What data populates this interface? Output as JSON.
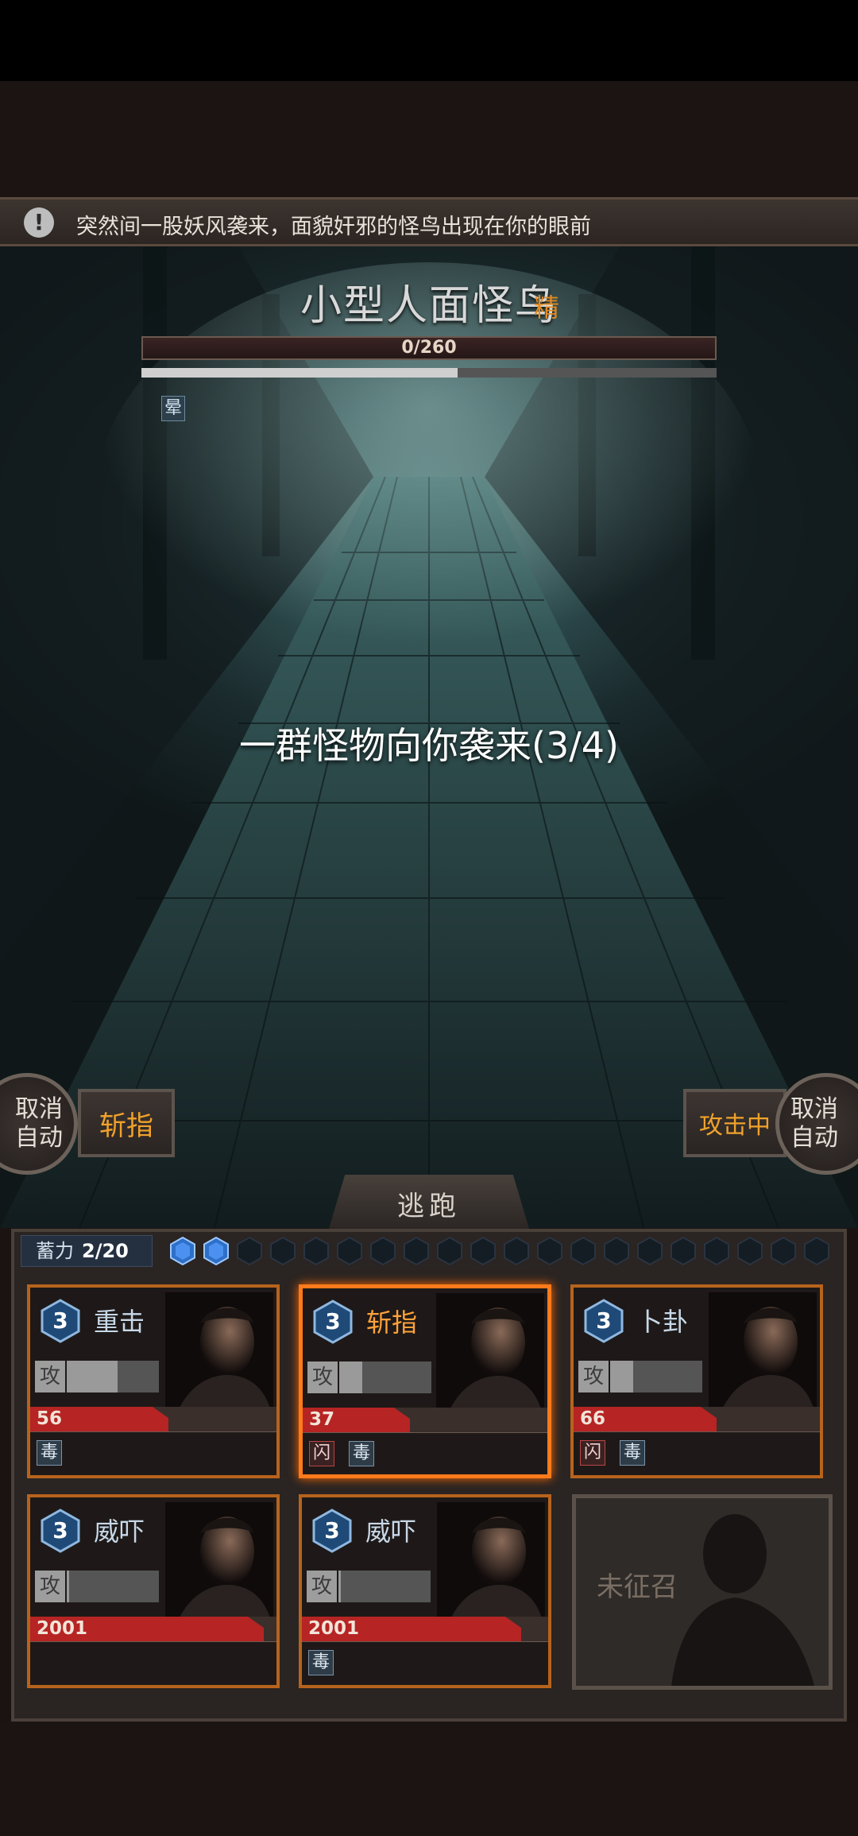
{
  "message": "突然间一股妖风袭来，面貌奸邪的怪鸟出现在你的眼前",
  "enemy": {
    "name": "小型人面怪鸟",
    "tag": "精",
    "hp_text": "0/260",
    "secondary_bar_fraction": 0.55,
    "status": "晕"
  },
  "wave_text": "一群怪物向你袭来(3/4)",
  "controls": {
    "cancel_auto_left": "取消\n自动",
    "left_skill": "斩指",
    "attacking": "攻击中",
    "cancel_auto_right": "取消\n自动",
    "flee": "逃跑"
  },
  "charge": {
    "label": "蓄力",
    "value": "2/20",
    "filled": 2,
    "total": 20
  },
  "cards": [
    {
      "level": "3",
      "skill": "重击",
      "atk_label": "攻",
      "atk_fraction": 0.55,
      "hp": "56",
      "hp_fraction": 0.58,
      "buffs": [
        "毒"
      ],
      "selected": false
    },
    {
      "level": "3",
      "skill": "斩指",
      "atk_label": "攻",
      "atk_fraction": 0.25,
      "hp": "37",
      "hp_fraction": 0.45,
      "buffs": [
        "闪",
        "毒"
      ],
      "selected": true
    },
    {
      "level": "3",
      "skill": "卜卦",
      "atk_label": "攻",
      "atk_fraction": 0.25,
      "hp": "66",
      "hp_fraction": 0.6,
      "buffs": [
        "闪",
        "毒"
      ],
      "selected": false
    },
    {
      "level": "3",
      "skill": "威吓",
      "atk_label": "攻",
      "atk_fraction": 0.03,
      "hp": "2001",
      "hp_fraction": 0.98,
      "buffs": [],
      "selected": false
    },
    {
      "level": "3",
      "skill": "威吓",
      "atk_label": "攻",
      "atk_fraction": 0.03,
      "hp": "2001",
      "hp_fraction": 0.92,
      "buffs": [
        "毒"
      ],
      "selected": false
    }
  ],
  "empty_slot_label": "未征召",
  "colors": {
    "accent": "#ff7a1a",
    "hp_red": "#b62424",
    "skill_orange": "#f0a22a"
  }
}
